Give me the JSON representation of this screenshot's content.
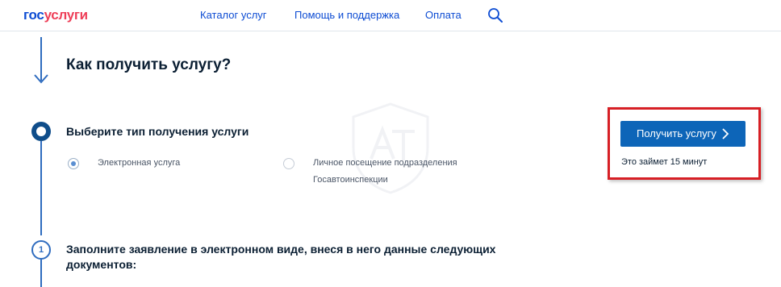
{
  "header": {
    "logo": {
      "part1": "гос",
      "part2": "услуги"
    },
    "nav": {
      "catalog": "Каталог услуг",
      "help": "Помощь и поддержка",
      "payment": "Оплата"
    },
    "search_icon": "search-icon"
  },
  "main": {
    "title": "Как получить услугу?",
    "step1": {
      "title": "Выберите тип получения услуги",
      "options": {
        "electronic": {
          "label": "Электронная услуга",
          "selected": true
        },
        "personal": {
          "line1": "Личное посещение подразделения",
          "line2": "Госавтоинспекции",
          "selected": false
        }
      }
    },
    "step2": {
      "number": "1",
      "title": "Заполните заявление в электронном виде, внеся в него данные следующих документов:"
    }
  },
  "action": {
    "button_label": "Получить услугу",
    "button_icon": "chevron-right-icon",
    "duration_note": "Это займет 15 минут"
  },
  "colors": {
    "brand_blue": "#0d4cd3",
    "brand_red": "#ee3f58",
    "button_blue": "#0d65b8",
    "highlight_red": "#d71f25"
  }
}
